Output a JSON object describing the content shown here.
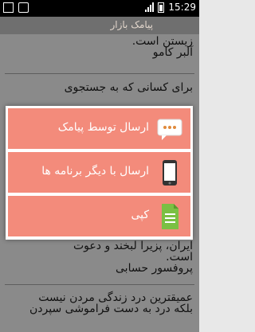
{
  "status_bar": {
    "time": "15:29"
  },
  "app": {
    "title": "پیامک بازار"
  },
  "quotes": [
    {
      "lines": [
        "زیستن است.",
        "آلبر کامو"
      ]
    },
    {
      "lines": [
        "برای کسانی که به جستجوی"
      ]
    },
    {
      "lines": [
        "ایران، پزیرا لبخند و دعوت",
        "است.",
        "پروفسور حسابی"
      ]
    },
    {
      "lines": [
        "عمیقترین درد زندگی مردن نیست",
        "بلکه درد به دست فراموشی سپردن"
      ]
    }
  ],
  "dialog": {
    "items": [
      {
        "label": "ارسال توسط پیامک",
        "icon": "sms-chat-icon"
      },
      {
        "label": "ارسال با دیگر برنامه ها",
        "icon": "smartphone-icon"
      },
      {
        "label": "کپی",
        "icon": "document-copy-icon"
      }
    ]
  },
  "colors": {
    "menu_item_bg": "#f38b7b",
    "title_bar_bg": "#6f6f6f",
    "status_bar_bg": "#000000"
  }
}
